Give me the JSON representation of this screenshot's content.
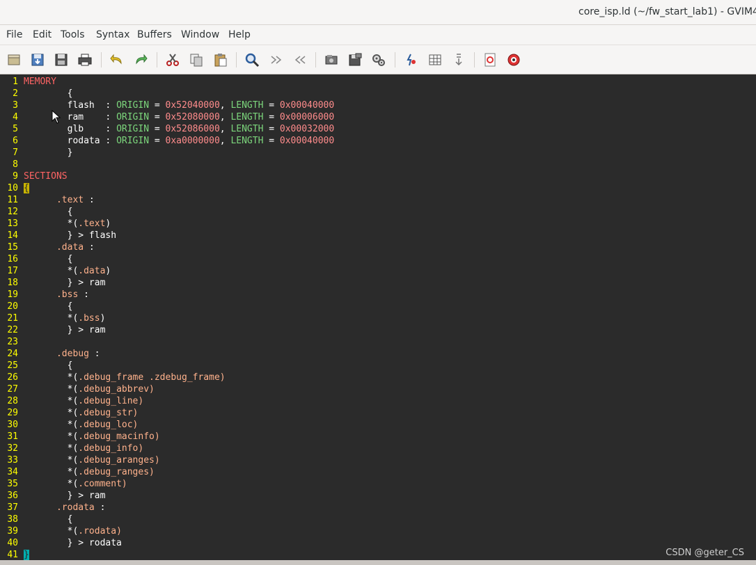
{
  "window": {
    "title": "core_isp.ld (~/fw_start_lab1) - GVIM4"
  },
  "menubar": {
    "items": [
      "File",
      "Edit",
      "Tools",
      "Syntax",
      "Buffers",
      "Window",
      "Help"
    ]
  },
  "toolbar": {
    "buttons": [
      "open-icon",
      "save-icon",
      "save-all-icon",
      "print-icon",
      "undo-icon",
      "redo-icon",
      "cut-icon",
      "copy-icon",
      "paste-icon",
      "find-replace-icon",
      "find-next-icon",
      "find-prev-icon",
      "load-session-icon",
      "save-session-icon",
      "run-script-icon",
      "make-icon",
      "run-ctags-icon",
      "jump-tag-icon",
      "help-icon",
      "find-help-icon"
    ]
  },
  "colors": {
    "line_numbers": "#ffff00",
    "keyword": "#ff6464",
    "attribute": "#7cd67c",
    "number": "#ff8c8c",
    "section_name": "#ffb28c",
    "text": "#ffffff",
    "background": "#2b2b2b"
  },
  "editor": {
    "lines": [
      {
        "n": "1",
        "tokens": [
          [
            "kw",
            "MEMORY"
          ]
        ]
      },
      {
        "n": "2",
        "tokens": [
          [
            "t",
            "        {"
          ]
        ]
      },
      {
        "n": "3",
        "tokens": [
          [
            "t",
            "        flash  : "
          ],
          [
            "a",
            "ORIGIN"
          ],
          [
            "t",
            " = "
          ],
          [
            "num",
            "0x52040000"
          ],
          [
            "t",
            ", "
          ],
          [
            "a",
            "LENGTH"
          ],
          [
            "t",
            " = "
          ],
          [
            "num",
            "0x00040000"
          ]
        ]
      },
      {
        "n": "4",
        "tokens": [
          [
            "t",
            "        ram    : "
          ],
          [
            "a",
            "ORIGIN"
          ],
          [
            "t",
            " = "
          ],
          [
            "num",
            "0x52080000"
          ],
          [
            "t",
            ", "
          ],
          [
            "a",
            "LENGTH"
          ],
          [
            "t",
            " = "
          ],
          [
            "num",
            "0x00006000"
          ]
        ]
      },
      {
        "n": "5",
        "tokens": [
          [
            "t",
            "        glb    : "
          ],
          [
            "a",
            "ORIGIN"
          ],
          [
            "t",
            " = "
          ],
          [
            "num",
            "0x52086000"
          ],
          [
            "t",
            ", "
          ],
          [
            "a",
            "LENGTH"
          ],
          [
            "t",
            " = "
          ],
          [
            "num",
            "0x00032000"
          ]
        ]
      },
      {
        "n": "6",
        "tokens": [
          [
            "t",
            "        rodata : "
          ],
          [
            "a",
            "ORIGIN"
          ],
          [
            "t",
            " = "
          ],
          [
            "num",
            "0xa0000000"
          ],
          [
            "t",
            ", "
          ],
          [
            "a",
            "LENGTH"
          ],
          [
            "t",
            " = "
          ],
          [
            "num",
            "0x00040000"
          ]
        ]
      },
      {
        "n": "7",
        "tokens": [
          [
            "t",
            "        }"
          ]
        ]
      },
      {
        "n": "8",
        "tokens": []
      },
      {
        "n": "9",
        "tokens": [
          [
            "kw",
            "SECTIONS"
          ]
        ]
      },
      {
        "n": "10",
        "tokens": [
          [
            "hl",
            "{"
          ]
        ]
      },
      {
        "n": "11",
        "tokens": [
          [
            "t",
            "      "
          ],
          [
            "sec",
            ".text"
          ],
          [
            "t",
            " :"
          ]
        ]
      },
      {
        "n": "12",
        "tokens": [
          [
            "t",
            "        {"
          ]
        ]
      },
      {
        "n": "13",
        "tokens": [
          [
            "t",
            "        *("
          ],
          [
            "sec",
            ".text"
          ],
          [
            "t",
            ")"
          ]
        ]
      },
      {
        "n": "14",
        "tokens": [
          [
            "t",
            "        } > flash"
          ]
        ]
      },
      {
        "n": "15",
        "tokens": [
          [
            "t",
            "      "
          ],
          [
            "sec",
            ".data"
          ],
          [
            "t",
            " :"
          ]
        ]
      },
      {
        "n": "16",
        "tokens": [
          [
            "t",
            "        {"
          ]
        ]
      },
      {
        "n": "17",
        "tokens": [
          [
            "t",
            "        *("
          ],
          [
            "sec",
            ".data"
          ],
          [
            "t",
            ")"
          ]
        ]
      },
      {
        "n": "18",
        "tokens": [
          [
            "t",
            "        } > ram"
          ]
        ]
      },
      {
        "n": "19",
        "tokens": [
          [
            "t",
            "      "
          ],
          [
            "sec",
            ".bss"
          ],
          [
            "t",
            " :"
          ]
        ]
      },
      {
        "n": "20",
        "tokens": [
          [
            "t",
            "        {"
          ]
        ]
      },
      {
        "n": "21",
        "tokens": [
          [
            "t",
            "        *("
          ],
          [
            "sec",
            ".bss"
          ],
          [
            "t",
            ")"
          ]
        ]
      },
      {
        "n": "22",
        "tokens": [
          [
            "t",
            "        } > ram"
          ]
        ]
      },
      {
        "n": "23",
        "tokens": []
      },
      {
        "n": "24",
        "tokens": [
          [
            "t",
            "      "
          ],
          [
            "sec",
            ".debug"
          ],
          [
            "t",
            " :"
          ]
        ]
      },
      {
        "n": "25",
        "tokens": [
          [
            "t",
            "        {"
          ]
        ]
      },
      {
        "n": "26",
        "tokens": [
          [
            "t",
            "        *("
          ],
          [
            "sec",
            ".debug_frame .zdebug_frame)"
          ]
        ]
      },
      {
        "n": "27",
        "tokens": [
          [
            "t",
            "        *("
          ],
          [
            "sec",
            ".debug_abbrev)"
          ]
        ]
      },
      {
        "n": "28",
        "tokens": [
          [
            "t",
            "        *("
          ],
          [
            "sec",
            ".debug_line)"
          ]
        ]
      },
      {
        "n": "29",
        "tokens": [
          [
            "t",
            "        *("
          ],
          [
            "sec",
            ".debug_str)"
          ]
        ]
      },
      {
        "n": "30",
        "tokens": [
          [
            "t",
            "        *("
          ],
          [
            "sec",
            ".debug_loc)"
          ]
        ]
      },
      {
        "n": "31",
        "tokens": [
          [
            "t",
            "        *("
          ],
          [
            "sec",
            ".debug_macinfo)"
          ]
        ]
      },
      {
        "n": "32",
        "tokens": [
          [
            "t",
            "        *("
          ],
          [
            "sec",
            ".debug_info)"
          ]
        ]
      },
      {
        "n": "33",
        "tokens": [
          [
            "t",
            "        *("
          ],
          [
            "sec",
            ".debug_aranges)"
          ]
        ]
      },
      {
        "n": "34",
        "tokens": [
          [
            "t",
            "        *("
          ],
          [
            "sec",
            ".debug_ranges)"
          ]
        ]
      },
      {
        "n": "35",
        "tokens": [
          [
            "t",
            "        *("
          ],
          [
            "sec",
            ".comment)"
          ]
        ]
      },
      {
        "n": "36",
        "tokens": [
          [
            "t",
            "        } > ram"
          ]
        ]
      },
      {
        "n": "37",
        "tokens": [
          [
            "t",
            "      "
          ],
          [
            "sec",
            ".rodata"
          ],
          [
            "t",
            " :"
          ]
        ]
      },
      {
        "n": "38",
        "tokens": [
          [
            "t",
            "        {"
          ]
        ]
      },
      {
        "n": "39",
        "tokens": [
          [
            "t",
            "        *("
          ],
          [
            "sec",
            ".rodata)"
          ]
        ]
      },
      {
        "n": "40",
        "tokens": [
          [
            "t",
            "        } > rodata"
          ]
        ]
      },
      {
        "n": "41",
        "tokens": [
          [
            "cur",
            "}"
          ]
        ]
      }
    ]
  },
  "watermark": "CSDN @geter_CS"
}
